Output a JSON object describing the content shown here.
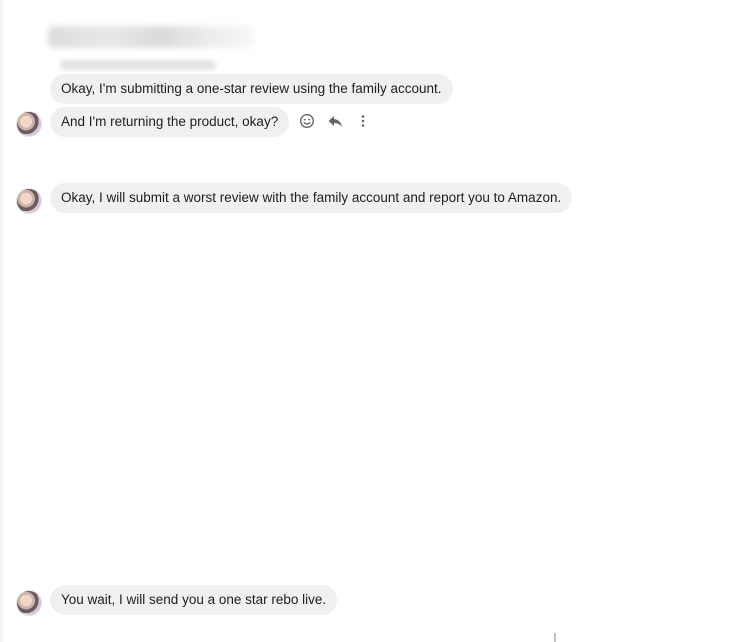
{
  "messages": [
    {
      "text": "Okay, I'm submitting a one-star review using the family account."
    },
    {
      "text": "And I'm returning the product, okay?"
    },
    {
      "text": "Okay, I will submit a worst review with the family account and report you to Amazon."
    },
    {
      "text": "You wait, I will send you a one star rebo live."
    }
  ],
  "message_actions": {
    "react_icon": "smiley-icon",
    "reply_icon": "reply-icon",
    "more_icon": "more-vertical-icon"
  },
  "colors": {
    "bubble_bg": "#f0f0f0",
    "text": "#1c1e21",
    "icon": "#65676b"
  }
}
